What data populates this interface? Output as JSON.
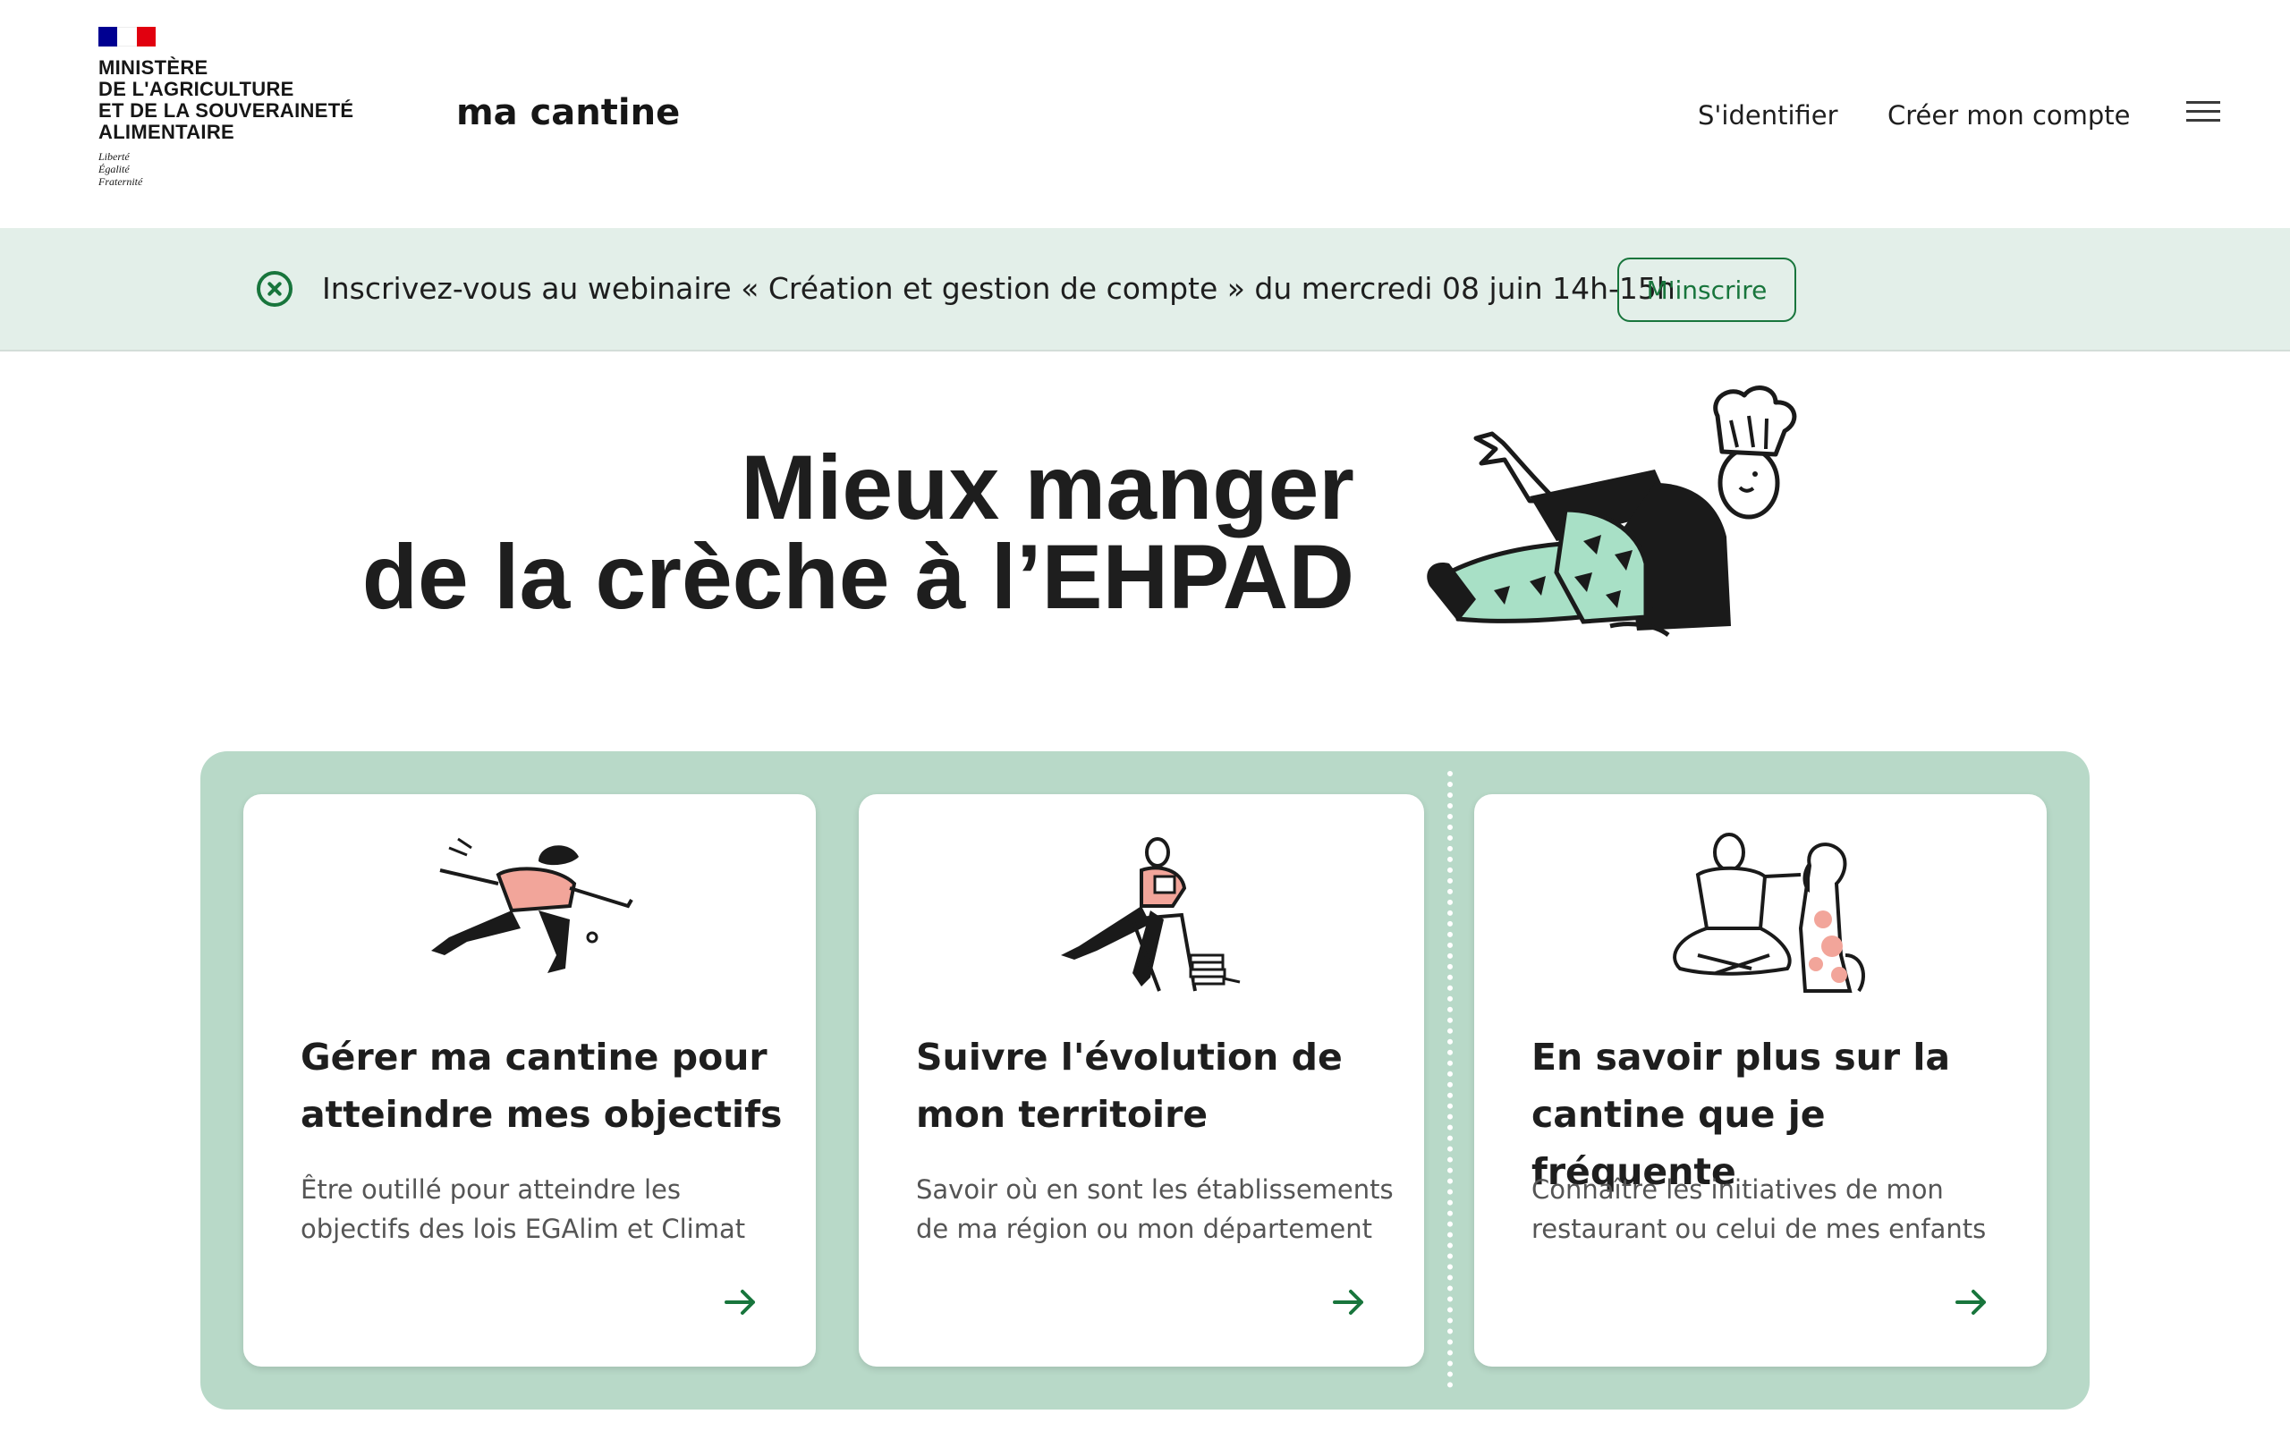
{
  "header": {
    "ministry": [
      "Ministère",
      "de l'Agriculture",
      "et de la Souveraineté",
      "alimentaire"
    ],
    "motto": [
      "Liberté",
      "Égalité",
      "Fraternité"
    ],
    "site_name": "ma cantine",
    "nav": {
      "login": "S'identifier",
      "create_account": "Créer mon compte"
    },
    "menu_icon": "hamburger-menu-icon"
  },
  "banner": {
    "icon": "close-circle-icon",
    "text": "Inscrivez-vous au webinaire « Création et gestion de compte » du mercredi 08 juin 14h-15h",
    "button": "M'inscrire"
  },
  "hero": {
    "title_line1": "Mieux manger",
    "title_line2": "de la crèche à l’EHPAD",
    "illustration": "chef-sitting-illustration"
  },
  "cards": [
    {
      "title": "Gérer ma cantine pour atteindre mes objectifs",
      "description": "Être outillé pour atteindre les objectifs des lois EGAlim et Climat",
      "illustration": "running-person-illustration",
      "arrow": "arrow-right-icon"
    },
    {
      "title": "Suivre l'évolution de mon territoire",
      "description": "Savoir où en sont les établissements de ma région ou mon département",
      "illustration": "person-reading-chair-illustration",
      "arrow": "arrow-right-icon"
    },
    {
      "title": "En savoir plus sur la cantine que je fréquente",
      "description": "Connaître les initiatives de mon restaurant ou celui de mes enfants",
      "illustration": "person-with-dog-illustration",
      "arrow": "arrow-right-icon"
    }
  ],
  "colors": {
    "accent_green": "#18753c",
    "banner_bg": "#e3efe9",
    "panel_bg": "#b8d9c8",
    "illustration_mint": "#a8e0c6",
    "illustration_pink": "#f2a59a"
  }
}
